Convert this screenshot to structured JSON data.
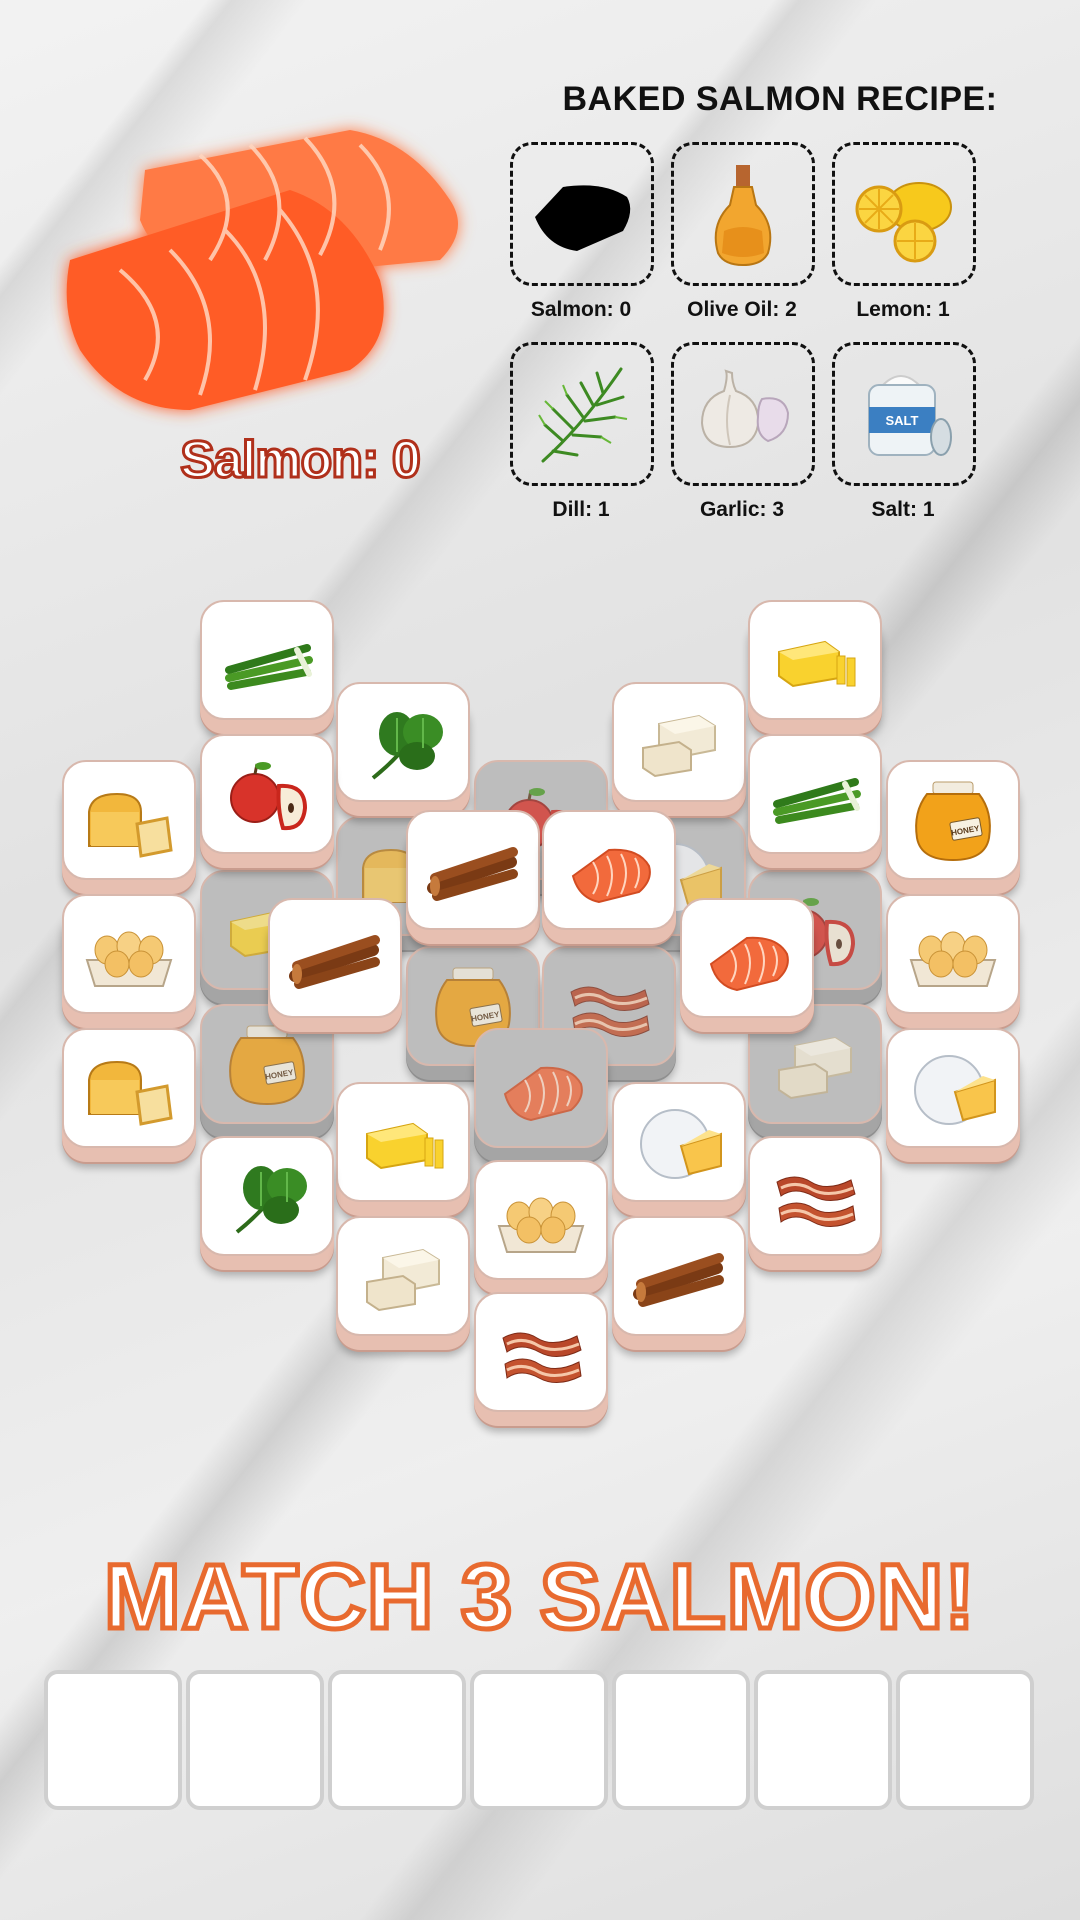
{
  "hero": {
    "icon": "salmon-icon",
    "count_label": "Salmon: 0"
  },
  "recipe": {
    "title": "BAKED SALMON RECIPE:",
    "items": [
      {
        "label": "Salmon: 0",
        "icon": "salmon-silhouette-icon"
      },
      {
        "label": "Olive Oil: 2",
        "icon": "olive-oil-icon"
      },
      {
        "label": "Lemon: 1",
        "icon": "lemon-icon"
      },
      {
        "label": "Dill: 1",
        "icon": "dill-icon"
      },
      {
        "label": "Garlic: 3",
        "icon": "garlic-icon"
      },
      {
        "label": "Salt: 1",
        "icon": "salt-icon"
      }
    ]
  },
  "board": {
    "tiles": [
      {
        "icon": "green-onion-icon",
        "covered": false
      },
      {
        "icon": "butter-icon",
        "covered": false
      },
      {
        "icon": "spinach-icon",
        "covered": false
      },
      {
        "icon": "tofu-icon",
        "covered": false
      },
      {
        "icon": "apple-icon",
        "covered": false
      },
      {
        "icon": "green-onion-icon",
        "covered": false
      },
      {
        "icon": "bread-icon",
        "covered": false
      },
      {
        "icon": "honey-icon",
        "covered": false
      },
      {
        "icon": "apple-icon",
        "covered": true
      },
      {
        "icon": "bread-icon",
        "covered": true
      },
      {
        "icon": "cheese-icon",
        "covered": true
      },
      {
        "icon": "cinnamon-icon",
        "covered": false
      },
      {
        "icon": "salmon-icon",
        "covered": false
      },
      {
        "icon": "eggs-icon",
        "covered": false
      },
      {
        "icon": "butter-icon",
        "covered": true
      },
      {
        "icon": "apple-icon",
        "covered": true
      },
      {
        "icon": "eggs-icon",
        "covered": false
      },
      {
        "icon": "honey-icon",
        "covered": true
      },
      {
        "icon": "bacon-icon",
        "covered": true
      },
      {
        "icon": "cinnamon-icon",
        "covered": false
      },
      {
        "icon": "salmon-icon",
        "covered": false
      },
      {
        "icon": "bread-icon",
        "covered": false
      },
      {
        "icon": "honey-icon",
        "covered": true
      },
      {
        "icon": "salmon-icon",
        "covered": true
      },
      {
        "icon": "tofu-icon",
        "covered": true
      },
      {
        "icon": "cheese-icon",
        "covered": false
      },
      {
        "icon": "butter-icon",
        "covered": false
      },
      {
        "icon": "cheese-icon",
        "covered": false
      },
      {
        "icon": "spinach-icon",
        "covered": false
      },
      {
        "icon": "eggs-icon",
        "covered": false
      },
      {
        "icon": "bacon-icon",
        "covered": false
      },
      {
        "icon": "tofu-icon",
        "covered": false
      },
      {
        "icon": "cinnamon-icon",
        "covered": false
      },
      {
        "icon": "bacon-icon",
        "covered": false
      }
    ]
  },
  "match_title": "MATCH 3 SALMON!",
  "slots": {
    "count": 7,
    "filled": 0
  }
}
